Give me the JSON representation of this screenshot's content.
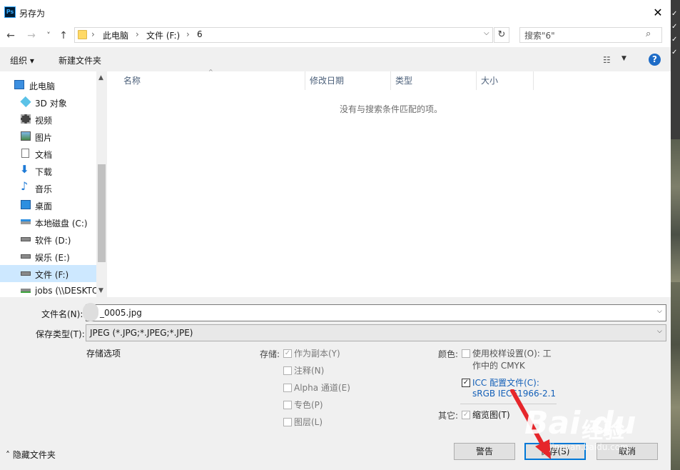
{
  "window": {
    "title": "另存为",
    "app_icon": "Ps",
    "close": "✕"
  },
  "nav": {
    "back": "←",
    "forward": "→",
    "recent": "˅",
    "up": "↑",
    "refresh": "↻"
  },
  "address": {
    "crumbs": [
      "此电脑",
      "文件 (F:)",
      "6"
    ],
    "sep": "›"
  },
  "search": {
    "placeholder": "搜索\"6\""
  },
  "toolbar": {
    "organize": "组织 ▾",
    "new_folder": "新建文件夹",
    "help": "?"
  },
  "sidebar": {
    "items": [
      {
        "label": "此电脑",
        "icon": "computer-icon"
      },
      {
        "label": "3D 对象",
        "icon": "cube-icon"
      },
      {
        "label": "视频",
        "icon": "film-icon"
      },
      {
        "label": "图片",
        "icon": "picture-icon"
      },
      {
        "label": "文档",
        "icon": "document-icon"
      },
      {
        "label": "下载",
        "icon": "download-icon"
      },
      {
        "label": "音乐",
        "icon": "music-icon"
      },
      {
        "label": "桌面",
        "icon": "desktop-icon"
      },
      {
        "label": "本地磁盘 (C:)",
        "icon": "windows-drive-icon"
      },
      {
        "label": "软件 (D:)",
        "icon": "drive-icon"
      },
      {
        "label": "娱乐 (E:)",
        "icon": "drive-icon"
      },
      {
        "label": "文件 (F:)",
        "icon": "drive-icon"
      },
      {
        "label": "jobs (\\\\DESKTO",
        "icon": "network-drive-icon"
      }
    ]
  },
  "columns": [
    "名称",
    "修改日期",
    "类型",
    "大小"
  ],
  "empty_message": "没有与搜索条件匹配的项。",
  "filename": {
    "label": "文件名(N):",
    "value": "_0005.jpg"
  },
  "filetype": {
    "label": "保存类型(T):",
    "value": "JPEG (*.JPG;*.JPEG;*.JPE)"
  },
  "save_options": {
    "title": "存储选项",
    "storage_label": "存储:",
    "storage": [
      {
        "label": "作为副本(Y)",
        "checked": true
      },
      {
        "label": "注释(N)",
        "checked": false
      },
      {
        "label": "Alpha 通道(E)",
        "checked": false
      },
      {
        "label": "专色(P)",
        "checked": false
      },
      {
        "label": "图层(L)",
        "checked": false
      }
    ],
    "color_label": "颜色:",
    "proof_line1": "使用校样设置(O): 工",
    "proof_line2": "作中的 CMYK",
    "icc_line1": "ICC 配置文件(C):",
    "icc_line2": "sRGB IEC61966-2.1",
    "other_label": "其它:",
    "thumbnail": "缩览图(T)"
  },
  "footer": {
    "hide_folders": "˄ 隐藏文件夹",
    "warn": "警告",
    "save": "保存(S)",
    "cancel": "取消"
  },
  "watermark": {
    "text": "经验",
    "brand": "Bai du",
    "url": "jingyan.baidu.com"
  },
  "colors": {
    "accent": "#0078d7",
    "selection": "#cde8ff",
    "link": "#1460b8",
    "arrow": "#e6262b"
  }
}
